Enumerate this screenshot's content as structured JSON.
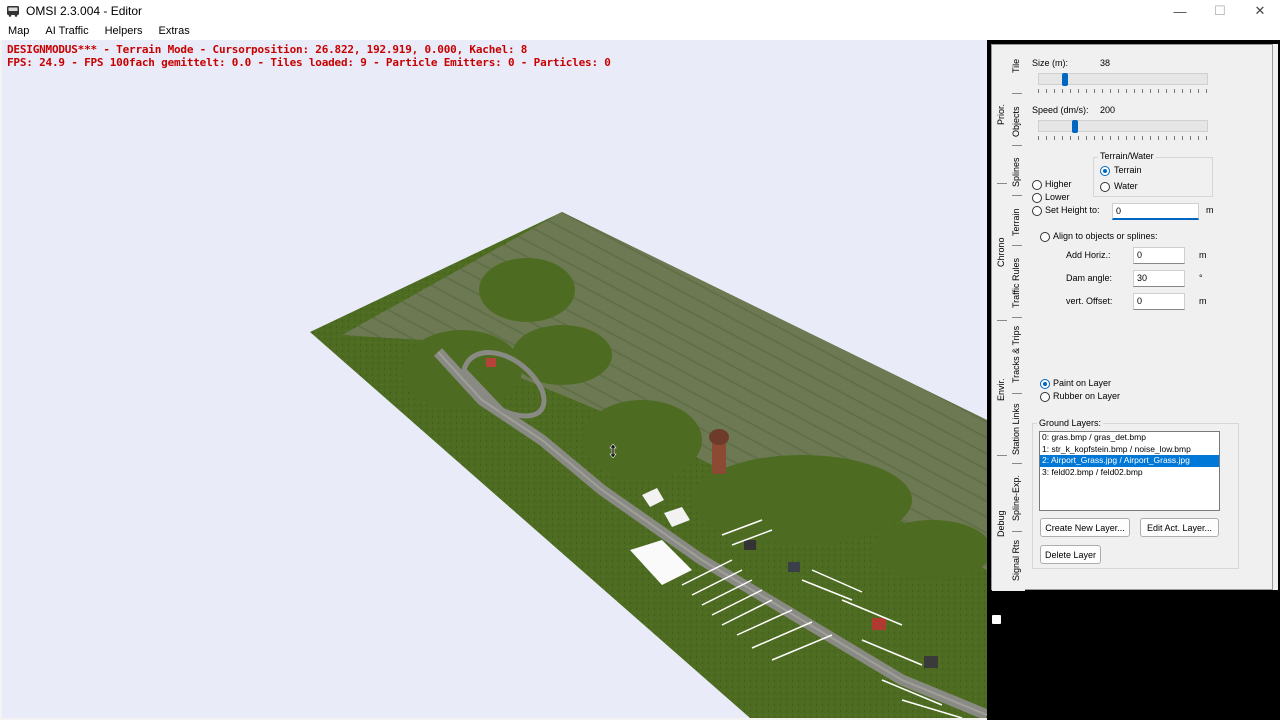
{
  "window": {
    "title": "OMSI 2.3.004 - Editor",
    "minimize": "—",
    "maximize": "☐",
    "close": "✕"
  },
  "menu": [
    "Map",
    "AI Traffic",
    "Helpers",
    "Extras"
  ],
  "overlay": {
    "line1": "DESIGNMODUS*** - Terrain Mode - Cursorposition: 26.822, 192.919, 0.000, Kachel: 8",
    "line2": "FPS: 24.9 - FPS 100fach gemittelt: 0.0 - Tiles loaded: 9 - Particle Emitters: 0 - Particles: 0"
  },
  "tabs_outer": [
    "Prior.",
    "Chrono",
    "Envir.",
    "Debug"
  ],
  "tabs_inner": [
    "Tile",
    "Objects",
    "Splines",
    "Terrain",
    "Traffic Rules",
    "Tracks & Trips",
    "Station Links",
    "Spline-Exp.",
    "Signal Rts"
  ],
  "terrain": {
    "size_label": "Size (m):",
    "size_value": "38",
    "size_fraction": 0.14,
    "speed_label": "Speed (dm/s):",
    "speed_value": "200",
    "speed_fraction": 0.2,
    "group_title": "Terrain/Water",
    "terrain_option": "Terrain",
    "water_option": "Water",
    "higher": "Higher",
    "lower": "Lower",
    "set_height": "Set Height to:",
    "set_height_value": "0",
    "unit_m": "m",
    "align": "Align to objects or splines:",
    "add_horiz_label": "Add Horiz.:",
    "add_horiz_value": "0",
    "dam_angle_label": "Dam angle:",
    "dam_angle_value": "30",
    "deg": "°",
    "vert_offset_label": "vert. Offset:",
    "vert_offset_value": "0",
    "paint_layer": "Paint on Layer",
    "rubber_layer": "Rubber on Layer",
    "ground_layers_title": "Ground Layers:",
    "layers": [
      "0: gras.bmp / gras_det.bmp",
      "1: str_k_kopfstein.bmp / noise_low.bmp",
      "2: Airport_Grass.jpg / Airport_Grass.jpg",
      "3: feld02.bmp / feld02.bmp"
    ],
    "selected_layer": 2,
    "create_layer": "Create New Layer...",
    "edit_layer": "Edit Act. Layer...",
    "delete_layer": "Delete Layer"
  },
  "colors": {
    "grass_dark": "#4a6a22",
    "grass_light": "#6b7a4a",
    "field": "#6f7a55",
    "road": "#8a8a84",
    "overlay_red": "#c80000",
    "accent": "#0067c0"
  }
}
